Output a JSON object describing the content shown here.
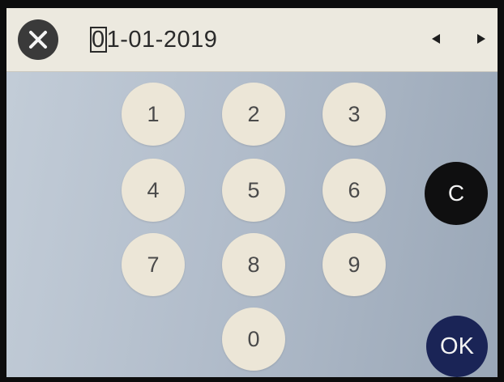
{
  "date_input": {
    "cursor_digit": "0",
    "rest": "1-01-2019"
  },
  "icons": {
    "close": "close-icon",
    "left": "arrow-left-icon",
    "right": "arrow-right-icon"
  },
  "keypad": {
    "k1": "1",
    "k2": "2",
    "k3": "3",
    "k4": "4",
    "k5": "5",
    "k6": "6",
    "k7": "7",
    "k8": "8",
    "k9": "9",
    "k0": "0",
    "clear": "C",
    "ok": "OK"
  },
  "colors": {
    "ok_button": "#1a2456",
    "clear_button": "#0f0f10",
    "digit_key": "#ece6d7"
  }
}
